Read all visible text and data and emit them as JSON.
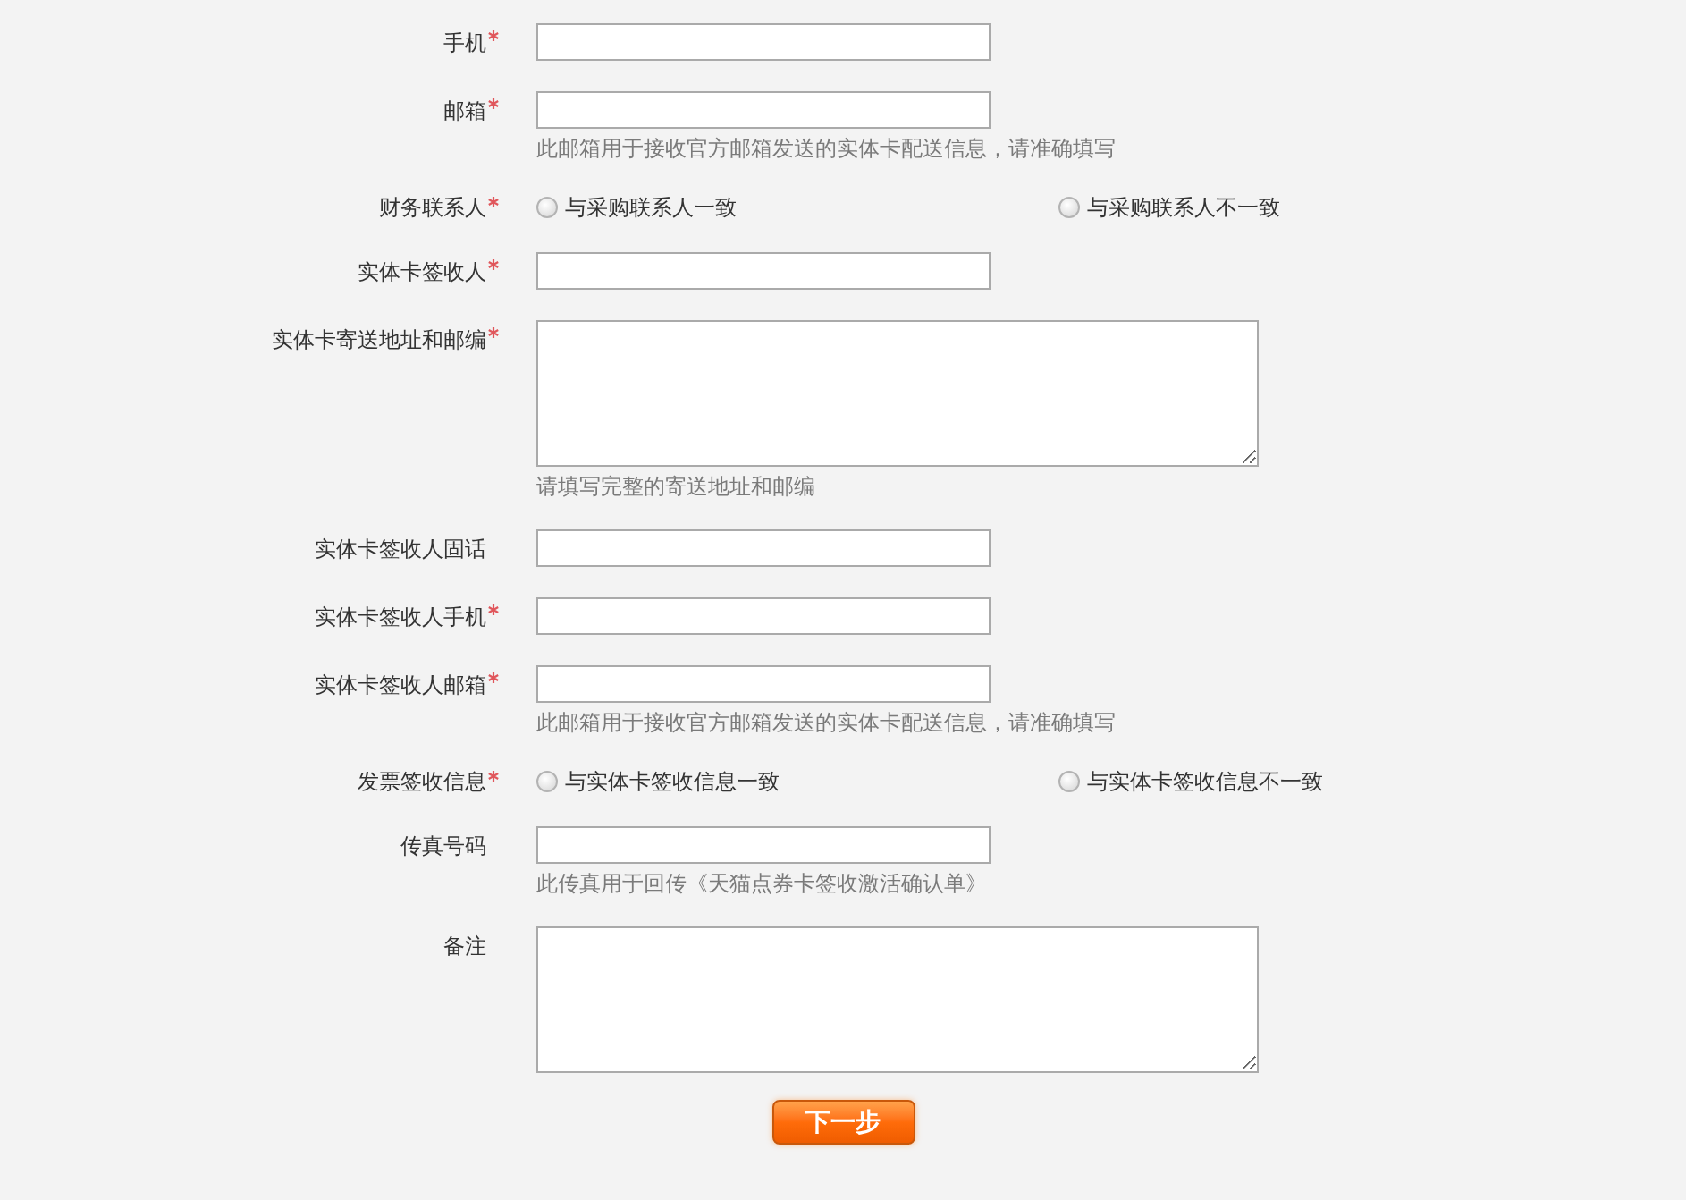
{
  "form": {
    "fields": [
      {
        "kind": "input",
        "label": "手机",
        "required": true
      },
      {
        "kind": "input",
        "label": "邮箱",
        "required": true,
        "hint": "此邮箱用于接收官方邮箱发送的实体卡配送信息，请准确填写"
      },
      {
        "kind": "radio",
        "label": "财务联系人",
        "required": true,
        "options": [
          {
            "label": "与采购联系人一致",
            "selected": false
          },
          {
            "label": "与采购联系人不一致",
            "selected": false
          }
        ]
      },
      {
        "kind": "input",
        "label": "实体卡签收人",
        "required": true
      },
      {
        "kind": "textarea",
        "label": "实体卡寄送地址和邮编",
        "required": true,
        "hint": "请填写完整的寄送地址和邮编"
      },
      {
        "kind": "input",
        "label": "实体卡签收人固话",
        "required": false
      },
      {
        "kind": "input",
        "label": "实体卡签收人手机",
        "required": true
      },
      {
        "kind": "input",
        "label": "实体卡签收人邮箱",
        "required": true,
        "hint": "此邮箱用于接收官方邮箱发送的实体卡配送信息，请准确填写"
      },
      {
        "kind": "radio",
        "label": "发票签收信息",
        "required": true,
        "options": [
          {
            "label": "与实体卡签收信息一致",
            "selected": false
          },
          {
            "label": "与实体卡签收信息不一致",
            "selected": false
          }
        ]
      },
      {
        "kind": "input",
        "label": "传真号码",
        "required": false,
        "hint": "此传真用于回传《天猫点券卡签收激活确认单》"
      },
      {
        "kind": "textarea",
        "label": "备注",
        "required": false
      }
    ]
  },
  "next_button": "下一步"
}
